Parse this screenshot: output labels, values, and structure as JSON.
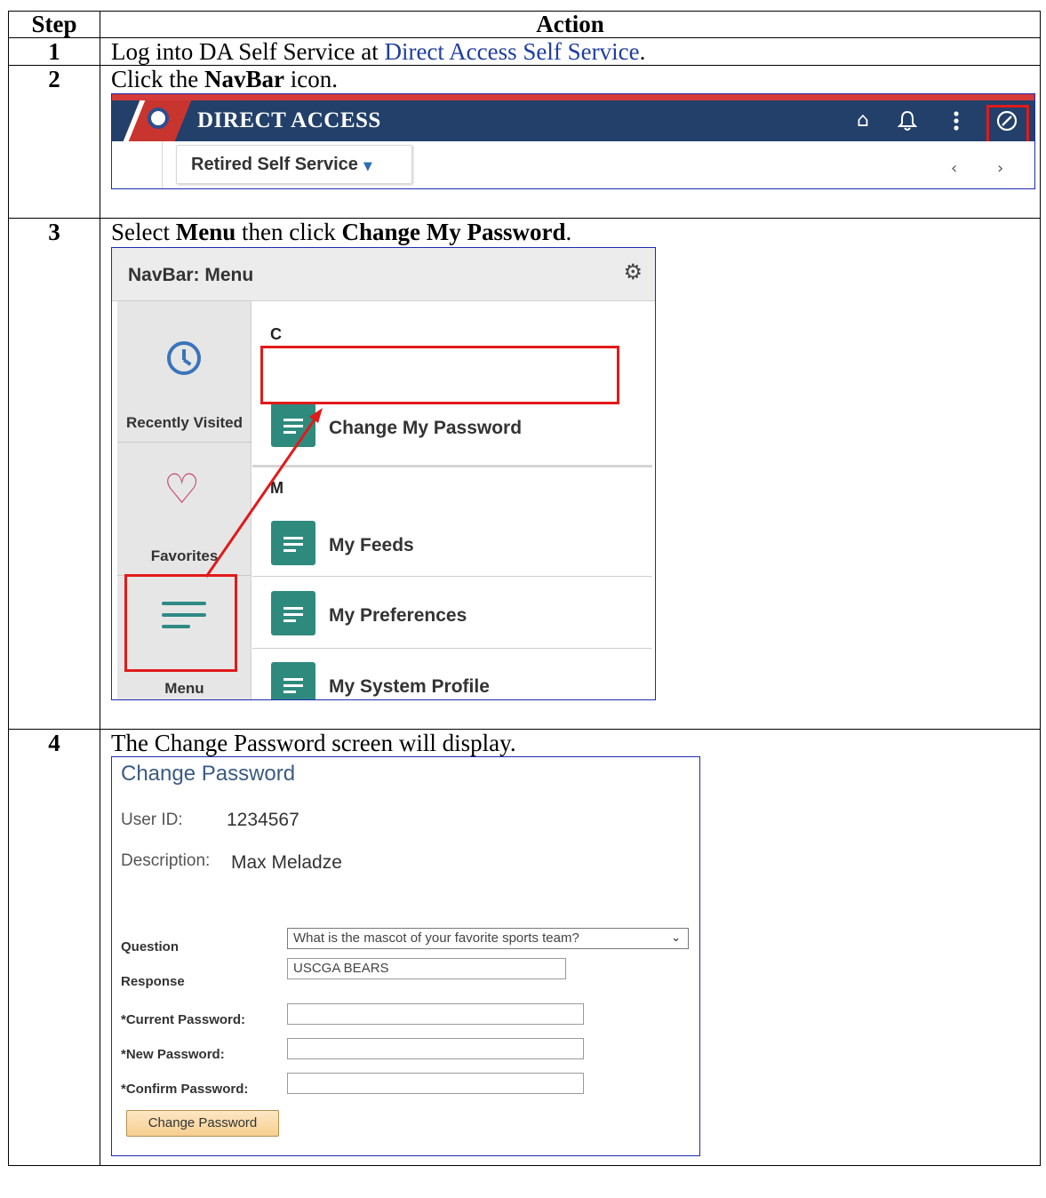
{
  "table": {
    "header_step": "Step",
    "header_action": "Action"
  },
  "steps": [
    {
      "number": "1",
      "text_before": "Log into DA Self Service at ",
      "link": "Direct Access Self Service",
      "text_after": "."
    },
    {
      "number": "2",
      "text_before": "Click the ",
      "bold": "NavBar",
      "text_after": " icon."
    },
    {
      "number": "3",
      "text_before": "Select ",
      "bold1": "Menu",
      "text_middle": " then click ",
      "bold2": "Change My Password",
      "text_after": "."
    },
    {
      "number": "4",
      "text": "The Change Password screen will display."
    }
  ],
  "header_shot": {
    "title": "DIRECT ACCESS",
    "tab_label": "Retired Self Service",
    "icons": [
      "home-icon",
      "bell-icon",
      "more-vertical-icon",
      "compass-icon"
    ],
    "brand_color": "#22406a",
    "accent_color": "#d43a3a"
  },
  "navbar_shot": {
    "title": "NavBar: Menu",
    "side_items": [
      "Recently Visited",
      "Favorites",
      "Menu"
    ],
    "groups": [
      {
        "letter": "C",
        "items": [
          "Change My Password"
        ]
      },
      {
        "letter": "M",
        "items": [
          "My Feeds",
          "My Preferences",
          "My System Profile"
        ]
      }
    ],
    "tile_color": "#2f8a7e",
    "highlight_color": "#e21a1a"
  },
  "change_password_shot": {
    "title": "Change Password",
    "user_id_label": "User ID:",
    "user_id_value": "1234567",
    "description_label": "Description:",
    "description_value": "Max Meladze",
    "question_label": "Question",
    "question_value": "What is the mascot of your favorite sports team?",
    "response_label": "Response",
    "response_value": "USCGA BEARS",
    "current_password_label": "*Current Password:",
    "new_password_label": "*New Password:",
    "confirm_password_label": "*Confirm Password:",
    "button_label": "Change Password"
  }
}
